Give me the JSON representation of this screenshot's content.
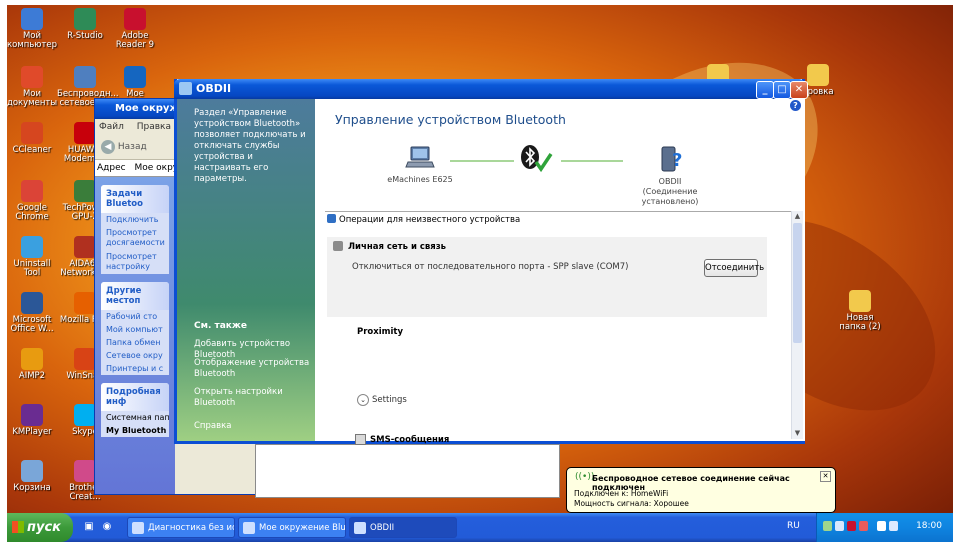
{
  "desktop": {
    "icons": [
      {
        "label": "Мой компьютер",
        "icon": "computer-icon",
        "color": "#3d7bd6"
      },
      {
        "label": "R-Studio",
        "icon": "rstudio-icon",
        "color": "#2e8b57"
      },
      {
        "label": "Adobe Reader 9",
        "icon": "pdf-icon",
        "color": "#c8102e"
      },
      {
        "label": "Мои документы",
        "icon": "documents-icon",
        "color": "#e04a2a"
      },
      {
        "label": "Беспроводн... сетевое с...",
        "icon": "wireless-icon",
        "color": "#4f7fbf"
      },
      {
        "label": "Мое",
        "icon": "bluetooth-icon",
        "color": "#1566c0"
      },
      {
        "label": "CCleaner",
        "icon": "ccleaner-icon",
        "color": "#d6461f"
      },
      {
        "label": "HUAWEI Modem 3.",
        "icon": "huawei-icon",
        "color": "#c7000b"
      },
      {
        "label": "Google Chrome",
        "icon": "chrome-icon",
        "color": "#db4437"
      },
      {
        "label": "TechPower GPU-Z",
        "icon": "gpuz-icon",
        "color": "#3a7d3a"
      },
      {
        "label": "Uninstall Tool",
        "icon": "uninstall-icon",
        "color": "#3aa0e0"
      },
      {
        "label": "AIDA64 Network Au",
        "icon": "aida64-icon",
        "color": "#b0301f"
      },
      {
        "label": "Microsoft Office W...",
        "icon": "word-icon",
        "color": "#2b5797"
      },
      {
        "label": "Mozilla Firef",
        "icon": "firefox-icon",
        "color": "#e66000"
      },
      {
        "label": "AIMP2",
        "icon": "aimp-icon",
        "color": "#e89b10"
      },
      {
        "label": "WinSnap",
        "icon": "winsnap-icon",
        "color": "#d84315"
      },
      {
        "label": "KMPlayer",
        "icon": "kmplayer-icon",
        "color": "#6a2c91"
      },
      {
        "label": "Skype",
        "icon": "skype-icon",
        "color": "#00aff0"
      },
      {
        "label": "Корзина",
        "icon": "recycle-bin-icon",
        "color": "#7aa6d8"
      },
      {
        "label": "Brother Creat...",
        "icon": "brother-icon",
        "color": "#d04a8a"
      }
    ],
    "right_icons": [
      {
        "label": "",
        "icon": "folder-icon"
      },
      {
        "label": "бровка",
        "icon": "folder-icon"
      },
      {
        "label": "Новая папка (2)",
        "icon": "folder-icon"
      }
    ]
  },
  "explorer": {
    "title": "Мое окружен",
    "menu": [
      "Файл",
      "Правка",
      "В"
    ],
    "back_label": "Назад",
    "address_label": "Адрес",
    "address_value": "Мое окру",
    "tasks_header": "Задачи Bluetoo",
    "tasks": [
      "Подключить",
      "Просмотрет досягаемости",
      "Просмотрет настройку"
    ],
    "places_header": "Другие местоп",
    "places": [
      "Рабочий сто",
      "Мой компьют",
      "Папка обмен",
      "Сетевое окру",
      "Принтеры и с"
    ],
    "details_header": "Подробная инф",
    "details": [
      "Системная папка",
      "My Bluetooth Pl"
    ]
  },
  "dialog": {
    "title": "OBDII",
    "left_description": "Раздел «Управление устройством Bluetooth» позволяет подключать и отключать службы устройства и настраивать его параметры.",
    "see_also": "См. также",
    "links": [
      "Добавить устройство Bluetooth",
      "Отображение устройства Bluetooth",
      "Открыть настройки Bluetooth",
      "Справка"
    ],
    "heading": "Управление устройством Bluetooth",
    "local_device": "eMachines E625",
    "remote_device": "OBDII",
    "remote_status": "(Соединение установлено)",
    "operations_header": "Операции для неизвестного устройства",
    "service_name": "Личная сеть и связь",
    "service_status": "Отключиться от последовательного порта - SPP slave (COM7)",
    "disconnect_button": "Отсоединить",
    "proximity": "Proximity",
    "settings": "Settings",
    "sms": "SMS-сообщения"
  },
  "balloon": {
    "title": "Беспроводное сетевое соединение сейчас подключен",
    "line1": "Подключен к: HomeWiFi",
    "line2": "Мощность сигнала: Хорошее"
  },
  "taskbar": {
    "start": "пуск",
    "tasks": [
      {
        "label": "Диагностика без ис...",
        "icon": "chrome-icon",
        "active": false
      },
      {
        "label": "Мое окружение Blue...",
        "icon": "bluetooth-icon",
        "active": false
      },
      {
        "label": "OBDII",
        "icon": "bluetooth-device-icon",
        "active": true
      }
    ],
    "language": "RU",
    "time": "18:00"
  },
  "colors": {
    "xp_blue": "#0b4ed4",
    "start_green": "#3c9a3a",
    "accent_heading": "#1f4e8c"
  }
}
